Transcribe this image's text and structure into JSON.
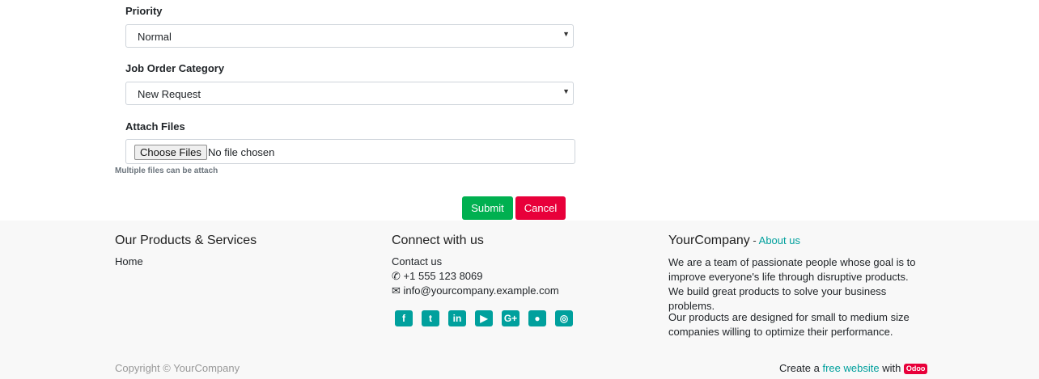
{
  "form": {
    "priority_label": "Priority",
    "priority_value": "Normal",
    "category_label": "Job Order Category",
    "category_value": "New Request",
    "attach_label": "Attach Files",
    "choose_button": "Choose Files",
    "no_file": "No file chosen",
    "hint": "Multiple files can be attach",
    "submit": "Submit",
    "cancel": "Cancel"
  },
  "footer": {
    "products_heading": "Our Products & Services",
    "home_link": "Home",
    "connect_heading": "Connect with us",
    "contact_link": "Contact us",
    "phone": "+1 555 123 8069",
    "email": "info@yourcompany.example.com",
    "social_icons": [
      "facebook-icon",
      "twitter-icon",
      "linkedin-icon",
      "youtube-icon",
      "google-plus-icon",
      "github-icon",
      "instagram-icon"
    ],
    "company_name": "YourCompany",
    "about_sep": " - ",
    "about_link": "About us",
    "about_p1": "We are a team of passionate people whose goal is to improve everyone's life through disruptive products. We build great products to solve your business problems.",
    "about_p2": "Our products are designed for small to medium size companies willing to optimize their performance.",
    "copyright": "Copyright © YourCompany",
    "create_prefix": "Create a ",
    "create_link": "free website",
    "create_with": " with ",
    "odoo_badge": "Odoo"
  },
  "colors": {
    "accent": "#00a09d",
    "submit": "#00b050",
    "cancel": "#e8003a"
  }
}
